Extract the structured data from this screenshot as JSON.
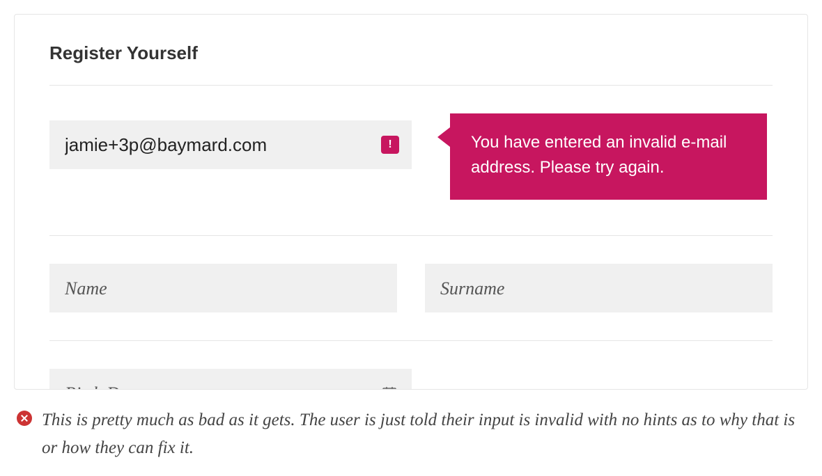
{
  "form": {
    "title": "Register Yourself",
    "email": {
      "value": "jamie+3p@baymard.com",
      "error_message": "You have entered an invalid e-mail address. Please try again."
    },
    "name": {
      "placeholder": "Name"
    },
    "surname": {
      "placeholder": "Surname"
    },
    "birth_date": {
      "placeholder": "Birth Date"
    }
  },
  "caption": {
    "text": "This is pretty much as bad as it gets. The user is just told their input is invalid with no hints as to why that is or how they can fix it."
  }
}
